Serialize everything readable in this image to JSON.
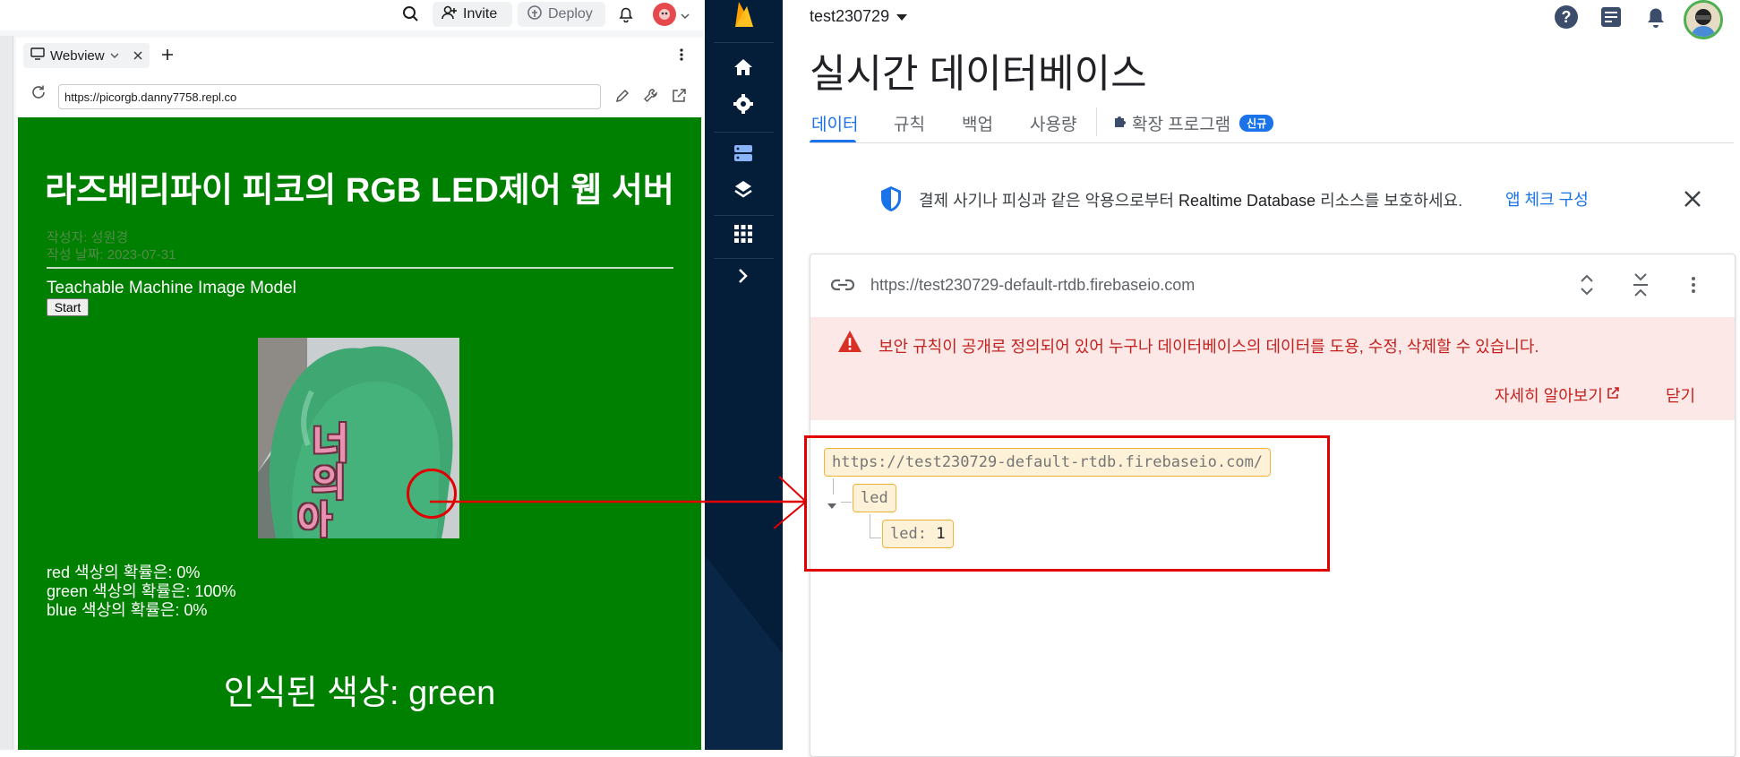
{
  "replit": {
    "header": {
      "invite_label": "Invite",
      "deploy_label": "Deploy"
    },
    "webview_tab": {
      "label": "Webview"
    },
    "url_bar": {
      "value": "https://picorgb.danny7758.repl.co"
    },
    "webpage": {
      "title": "라즈베리파이 피코의 RGB LED제어 웹 서버",
      "author": "작성자: 성원경",
      "date": "작성 날짜: 2023-07-31",
      "model_label": "Teachable Machine Image Model",
      "start_button": "Start",
      "probabilities": [
        "red 색상의 확률은: 0%",
        "green 색상의 확률은: 100%",
        "blue 색상의 확률은: 0%"
      ],
      "detected_color": "인식된 색상: green",
      "webcam_handwriting": [
        "너",
        "의",
        "아"
      ]
    }
  },
  "firebase": {
    "project_name": "test230729",
    "page_title": "실시간 데이터베이스",
    "tabs": [
      "데이터",
      "규칙",
      "백업",
      "사용량"
    ],
    "extensions_tab": "확장 프로그램",
    "new_badge": "신규",
    "app_check": {
      "message_prefix": "결제 사기나 피싱과 같은 악용으로부터 ",
      "message_product": "Realtime Database",
      "message_suffix": " 리소스를 보호하세요.",
      "link_label": "앱 체크 구성"
    },
    "database": {
      "url": "https://test230729-default-rtdb.firebaseio.com",
      "warning": "보안 규칙이 공개로 정의되어 있어 누구나 데이터베이스의 데이터를 도용, 수정, 삭제할 수 있습니다.",
      "learn_more": "자세히 알아보기",
      "close_label": "닫기",
      "tree": {
        "root": "https://test230729-default-rtdb.firebaseio.com/",
        "child": "led",
        "leaf_key": "led:",
        "leaf_value": "1"
      }
    }
  },
  "colors": {
    "page_green": "#008000",
    "firebase_nav": "#041e3a",
    "accent_blue": "#1a73e8",
    "warning_red": "#c5221f",
    "annotation_red": "#e00000"
  }
}
